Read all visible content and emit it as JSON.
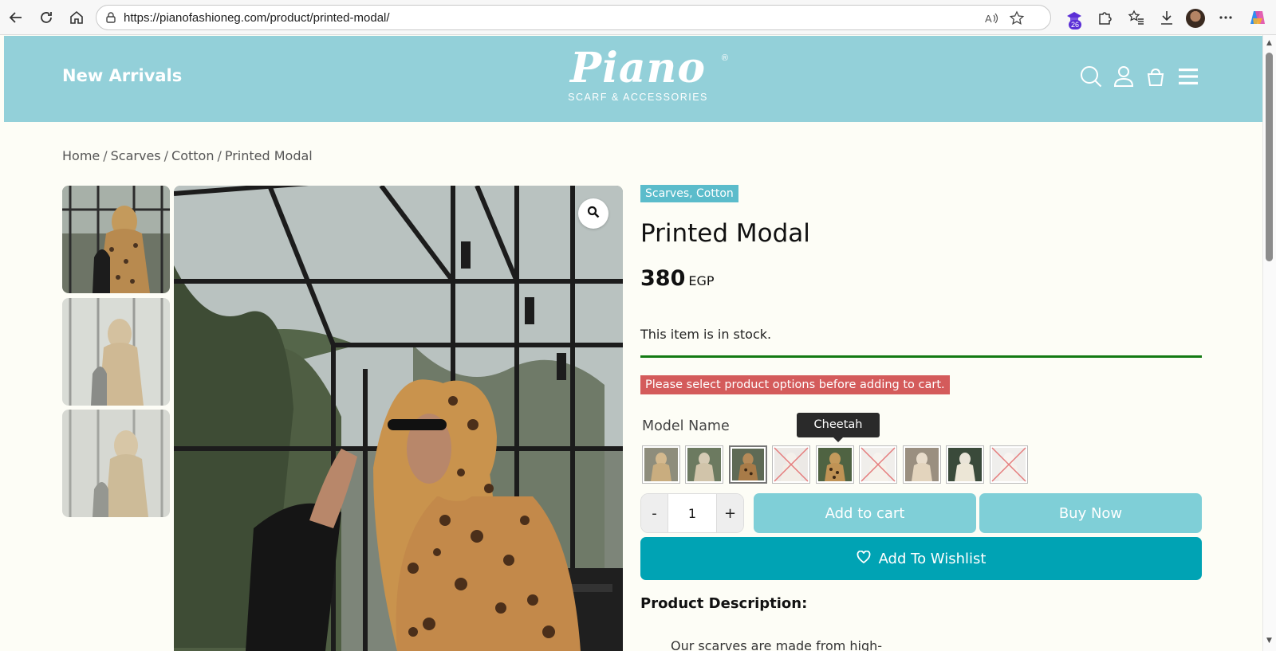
{
  "browser": {
    "url": "https://pianofashioneg.com/product/printed-modal/",
    "extension_badge": "26"
  },
  "header": {
    "new_arrivals": "New Arrivals",
    "logo_word": "Piano",
    "logo_reg": "®",
    "logo_tagline": "SCARF & ACCESSORIES",
    "bg_color": "#93d0d9"
  },
  "breadcrumb": [
    "Home",
    "Scarves",
    "Cotton",
    "Printed Modal"
  ],
  "product": {
    "categories": "Scarves, Cotton",
    "title": "Printed Modal",
    "price": "380",
    "currency": "EGP",
    "stock": "This item is in stock.",
    "warning": "Please select product options before adding to cart.",
    "option_label": "Model Name",
    "tooltip": "Cheetah",
    "quantity": "1",
    "qty_minus": "-",
    "qty_plus": "+",
    "add_to_cart": "Add to cart",
    "buy_now": "Buy Now",
    "wishlist": "Add To Wishlist",
    "description_title": "Product Description:",
    "description_text": "Our scarves are made from high-"
  },
  "colors": {
    "accent": "#00a3b4",
    "button_light": "#7fcfd7",
    "tag": "#5bbccb",
    "warning": "#d45b5b",
    "stock_bar": "#137a13"
  }
}
